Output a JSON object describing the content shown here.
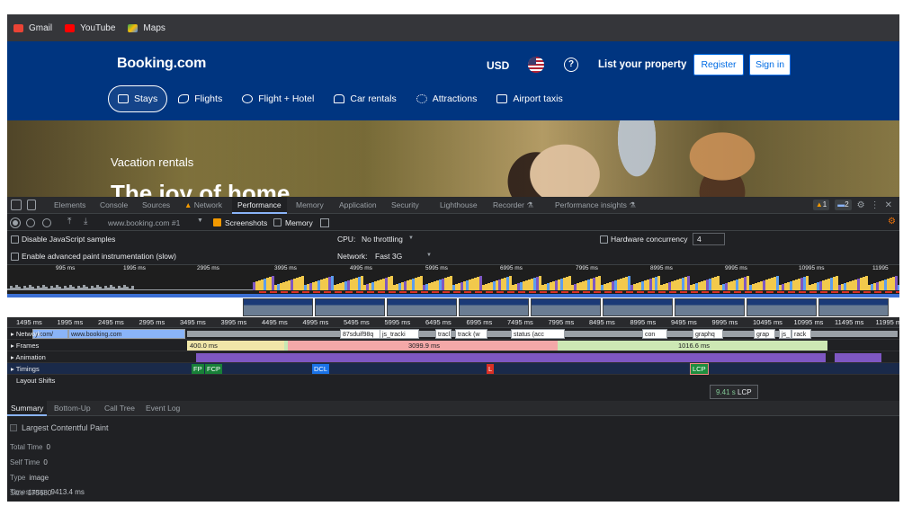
{
  "bookmarks": [
    {
      "label": "Gmail",
      "icon": "gmail-icon",
      "color": "#ea4335"
    },
    {
      "label": "YouTube",
      "icon": "youtube-icon",
      "color": "#ff0000"
    },
    {
      "label": "Maps",
      "icon": "maps-icon",
      "color": "#34a853"
    }
  ],
  "booking": {
    "logo": "Booking.com",
    "currency": "USD",
    "help": "?",
    "list_property": "List your property",
    "register": "Register",
    "sign_in": "Sign in",
    "brand_color": "#003580",
    "nav": [
      {
        "label": "Stays",
        "icon": "bed-icon"
      },
      {
        "label": "Flights",
        "icon": "plane-icon"
      },
      {
        "label": "Flight + Hotel",
        "icon": "flight-hotel-icon"
      },
      {
        "label": "Car rentals",
        "icon": "car-icon"
      },
      {
        "label": "Attractions",
        "icon": "attractions-icon"
      },
      {
        "label": "Airport taxis",
        "icon": "taxi-icon"
      }
    ],
    "hero_sub": "Vacation rentals",
    "hero_title": "The joy of home"
  },
  "devtools": {
    "tabs": [
      "Elements",
      "Console",
      "Sources",
      "Network",
      "Performance",
      "Memory",
      "Application",
      "Security",
      "Lighthouse",
      "Recorder",
      "Performance insights"
    ],
    "active_tab": "Performance",
    "warn_count": "1",
    "msg_count": "2",
    "toolbar": {
      "recording": "www.booking.com #1",
      "screenshots": "Screenshots",
      "memory": "Memory"
    },
    "settings": {
      "disable_js": "Disable JavaScript samples",
      "paint": "Enable advanced paint instrumentation (slow)",
      "cpu_label": "CPU:",
      "cpu_value": "No throttling",
      "network_label": "Network:",
      "network_value": "Fast 3G",
      "hc_label": "Hardware concurrency",
      "hc_value": "4"
    },
    "overview_ticks": [
      "995 ms",
      "1995 ms",
      "2995 ms",
      "3995 ms",
      "4995 ms",
      "5995 ms",
      "6995 ms",
      "7995 ms",
      "8995 ms",
      "9995 ms",
      "10995 ms",
      "11995"
    ],
    "timeline_ticks": [
      "1495 ms",
      "1995 ms",
      "2495 ms",
      "2995 ms",
      "3495 ms",
      "3995 ms",
      "4495 ms",
      "4995 ms",
      "5495 ms",
      "5995 ms",
      "6495 ms",
      "6995 ms",
      "7495 ms",
      "7995 ms",
      "8495 ms",
      "8995 ms",
      "9495 ms",
      "9995 ms",
      "10495 ms",
      "10995 ms",
      "11495 ms",
      "11995 ms"
    ],
    "tracks": {
      "network": "Network",
      "frames": "Frames",
      "animation": "Animation",
      "timings": "Timings",
      "layout_shifts": "Layout Shifts"
    },
    "network_requests": [
      "y.com/",
      "www.booking.com",
      "87sduif98q",
      "js_tracki",
      "tracl",
      "track (w",
      "status (acc",
      "con",
      "graphq",
      "grap",
      "js_",
      "rack"
    ],
    "frames": [
      "400.0 ms",
      "3099.9 ms",
      "1016.6 ms"
    ],
    "markers": {
      "fp": "FP",
      "fcp": "FCP",
      "dcl": "DCL",
      "l": "L",
      "lcp": "LCP"
    },
    "lcp_tooltip_time": "9.41 s",
    "lcp_tooltip_label": "LCP",
    "bottom_tabs": [
      "Summary",
      "Bottom-Up",
      "Call Tree",
      "Event Log"
    ],
    "summary": {
      "title": "Largest Contentful Paint",
      "total_time_label": "Total Time",
      "total_time": "0",
      "self_time_label": "Self Time",
      "self_time": "0",
      "type_label": "Type",
      "type": "image",
      "size_label": "Size",
      "size": "175680",
      "timestamp_label": "Timestamp",
      "timestamp": "9413.4 ms"
    }
  }
}
